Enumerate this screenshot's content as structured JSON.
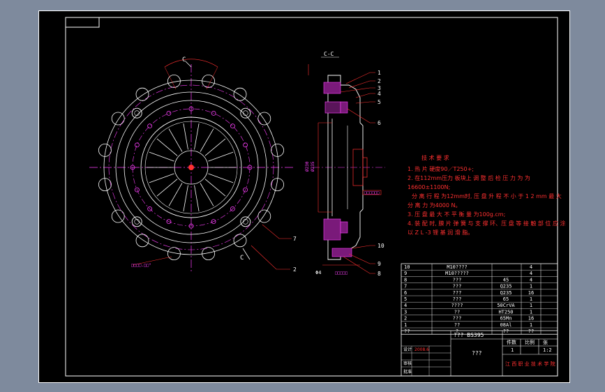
{
  "drawing": {
    "section_label": "C-C",
    "cut_label_top": "C",
    "cut_label_bottom": "C",
    "dim_left_a": "Ø230",
    "dim_left_b": "Ø235",
    "dim_right_label": "□□□□□□",
    "dim_bottom_right": "Φ4",
    "dim_bottom_mid": "□□□□□",
    "dim_angle_front": "□□□□.□□°",
    "callouts_right": [
      "1",
      "2",
      "3",
      "4",
      "5",
      "6",
      "10",
      "9",
      "8"
    ],
    "callouts_front": [
      "7",
      "2"
    ]
  },
  "tech_requirements": {
    "title": "技 术 要 求",
    "lines": [
      "1. 热 片 硬度90／T250+;",
      "2. 在112mm压力 板块上 调 整 后 检 压 力 为 为",
      "16600±1100N;",
      "分 离 行 程 为12mm时, 压 盘 升 程 不 小 于 1 2 mm 最 大",
      "分 离 力 为4000 N。",
      "3. 压 盘 最 大 不 平 衡 量 为100g.cm;",
      "4. 装 配 时, 膜 片 弹 簧 与 支 撑 环、压 盘 等 接 触 部 位 应 涂",
      "以 Z L -3 锂 基 润 滑 脂。"
    ]
  },
  "parts_table": {
    "rows": [
      {
        "no": "10",
        "name": "M10????",
        "mat": "",
        "qty": "4"
      },
      {
        "no": "9",
        "name": "M10?????",
        "mat": "",
        "qty": "4"
      },
      {
        "no": "8",
        "name": "???",
        "mat": "45",
        "qty": "4"
      },
      {
        "no": "7",
        "name": "???",
        "mat": "Q235",
        "qty": "1"
      },
      {
        "no": "6",
        "name": "???",
        "mat": "Q235",
        "qty": "16"
      },
      {
        "no": "5",
        "name": "???",
        "mat": "65",
        "qty": "1"
      },
      {
        "no": "4",
        "name": "????",
        "mat": "50CrVA",
        "qty": "1"
      },
      {
        "no": "3",
        "name": "??",
        "mat": "HT250",
        "qty": "1"
      },
      {
        "no": "2",
        "name": "???",
        "mat": "65Mn",
        "qty": "16"
      },
      {
        "no": "1",
        "name": "??",
        "mat": "08Al",
        "qty": "1"
      }
    ],
    "footer": {
      "no": "??",
      "name": "?",
      "mat": "??",
      "qty": "??"
    }
  },
  "title_block": {
    "drawing_name": "??? BS395",
    "subname": "???",
    "school": "江 西 职 业 技 术 学 院",
    "scale_label": "比例",
    "sheet_label": "张",
    "qty_label": "件数",
    "qty_value": "1",
    "scale_value": "1:2",
    "designer_label": "设计",
    "checker_label": "审核",
    "approve_label": "批准",
    "date_value": "2008.6"
  },
  "colors": {
    "outline": "#ffffff",
    "center_line": "#ff40ff",
    "dimension": "#ff3030",
    "hatch": "#ff40ff",
    "background": "#000000",
    "border_bg": "#7e8a9d"
  }
}
